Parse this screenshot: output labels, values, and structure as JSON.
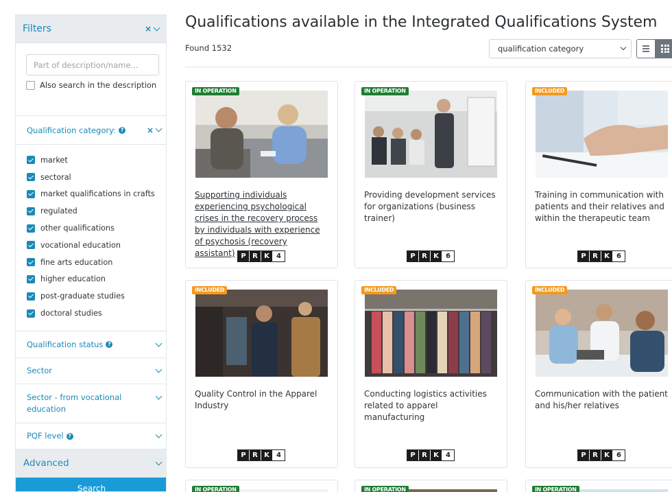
{
  "sidebar": {
    "header": "Filters",
    "close_icon": "×",
    "search": {
      "placeholder": "Part of description/name...",
      "value": ""
    },
    "also_search_label": "Also search in the description",
    "category": {
      "label": "Qualification category:",
      "items": [
        {
          "label": "market",
          "checked": true
        },
        {
          "label": "sectoral",
          "checked": true
        },
        {
          "label": "market qualifications in crafts",
          "checked": true
        },
        {
          "label": "regulated",
          "checked": true
        },
        {
          "label": "other qualifications",
          "checked": true
        },
        {
          "label": "vocational education",
          "checked": true
        },
        {
          "label": "fine arts education",
          "checked": true
        },
        {
          "label": "higher education",
          "checked": true
        },
        {
          "label": "post-graduate studies",
          "checked": true
        },
        {
          "label": "doctoral studies",
          "checked": true
        }
      ]
    },
    "status_label": "Qualification status",
    "sector_label": "Sector",
    "sector_voc_label": "Sector - from vocational education",
    "pqf_label": "PQF level",
    "advanced_label": "Advanced",
    "search_button": "Search"
  },
  "main": {
    "title": "Qualifications available in the Integrated Qualifications System",
    "found_text": "Found 1532",
    "sort_value": "qualification category"
  },
  "prk_letters": [
    "P",
    "R",
    "K"
  ],
  "cards": [
    {
      "badge": "IN OPERATION",
      "title": "Supporting individuals experiencing psychological crises in the recovery process by individuals with experience of psychosis (recovery assistant)",
      "level": "4",
      "linked": true
    },
    {
      "badge": "IN OPERATION",
      "title": "Providing development services for organizations (business trainer)",
      "level": "6",
      "linked": false
    },
    {
      "badge": "INCLUDED",
      "title": "Training in communication with patients and their relatives and within the therapeutic team",
      "level": "6",
      "linked": false
    },
    {
      "badge": "INCLUDED",
      "title": "Quality Control in the Apparel Industry",
      "level": "4",
      "linked": false
    },
    {
      "badge": "INCLUDED",
      "title": "Conducting logistics activities related to apparel manufacturing",
      "level": "4",
      "linked": false
    },
    {
      "badge": "INCLUDED",
      "title": "Communication with the patient and his/her relatives",
      "level": "6",
      "linked": false
    },
    {
      "badge": "IN OPERATION"
    },
    {
      "badge": "IN OPERATION"
    },
    {
      "badge": "IN OPERATION"
    }
  ],
  "colors": {
    "accent": "#1a8ab8",
    "button": "#1a9bd7",
    "badge_operation": "#1e7d32",
    "badge_included": "#f39a1f"
  }
}
